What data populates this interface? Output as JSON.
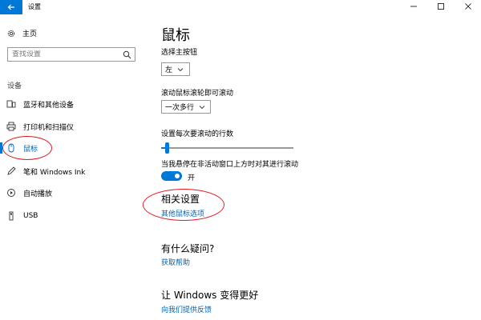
{
  "window": {
    "title": "设置",
    "back_icon": "back-arrow-icon",
    "controls": [
      "minimize-icon",
      "maximize-icon",
      "close-icon"
    ]
  },
  "sidebar": {
    "home_label": "主页",
    "search_placeholder": "查找设置",
    "section_label": "设备",
    "items": [
      {
        "label": "蓝牙和其他设备",
        "icon": "bluetooth-devices-icon"
      },
      {
        "label": "打印机和扫描仪",
        "icon": "printer-icon"
      },
      {
        "label": "鼠标",
        "icon": "mouse-icon",
        "active": true
      },
      {
        "label": "笔和 Windows Ink",
        "icon": "pen-icon"
      },
      {
        "label": "自动播放",
        "icon": "autoplay-icon"
      },
      {
        "label": "USB",
        "icon": "usb-icon"
      }
    ]
  },
  "main": {
    "title": "鼠标",
    "primary_button_label": "选择主按钮",
    "primary_button_value": "左",
    "scroll_label": "滚动鼠标滚轮即可滚动",
    "scroll_value": "一次多行",
    "lines_label": "设置每次要滚动的行数",
    "lines_slider_fraction": 0.03,
    "inactive_scroll_label": "当我悬停在非活动窗口上方时对其进行滚动",
    "inactive_scroll_state": "开",
    "related_heading": "相关设置",
    "related_link": "其他鼠标选项",
    "help_heading": "有什么疑问?",
    "help_link": "获取帮助",
    "improve_heading": "让 Windows 变得更好",
    "feedback_link": "向我们提供反馈"
  },
  "colors": {
    "accent": "#0078d7",
    "link": "#0063b1",
    "annotation": "#e21a22"
  }
}
